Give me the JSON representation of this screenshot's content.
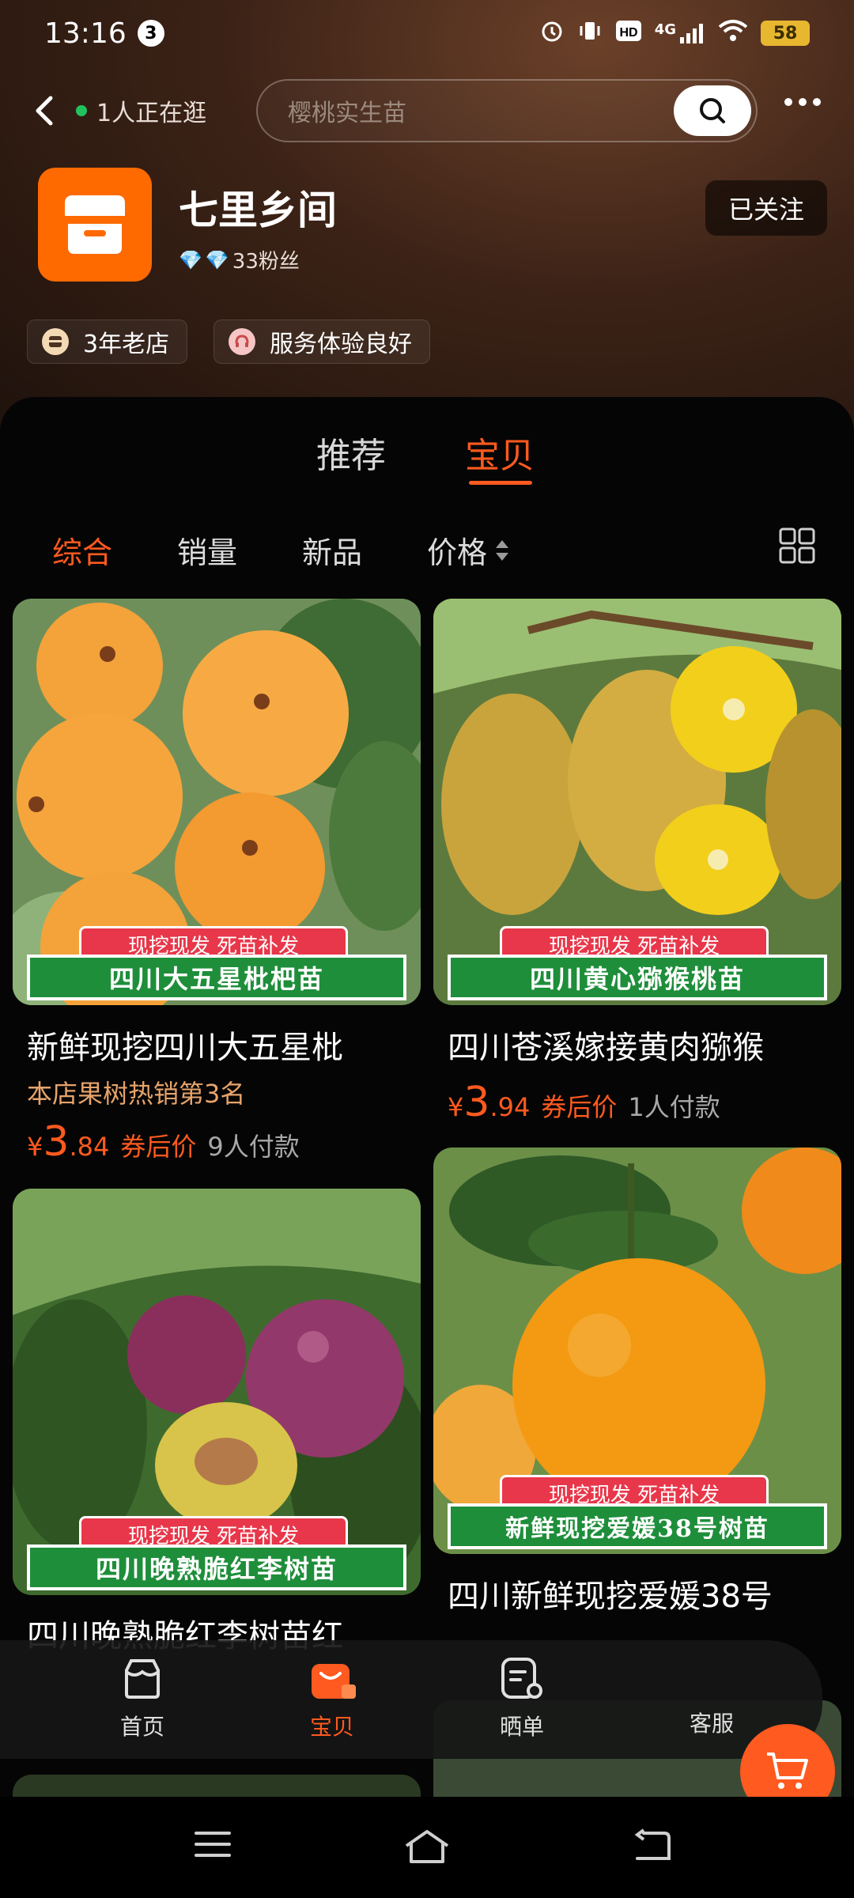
{
  "status_bar": {
    "time": "13:16",
    "notification_count": "3",
    "battery": "58",
    "network": "4G"
  },
  "top_bar": {
    "live_visitors": "1人正在逛",
    "search_placeholder": "樱桃实生苗"
  },
  "shop": {
    "name": "七里乡间",
    "fans": "33粉丝",
    "follow_label": "已关注",
    "tags": [
      "3年老店",
      "服务体验良好"
    ]
  },
  "main_tabs": {
    "recommend": "推荐",
    "products": "宝贝"
  },
  "sort": {
    "comprehensive": "综合",
    "sales": "销量",
    "new": "新品",
    "price": "价格"
  },
  "products": [
    {
      "promo_top": "现挖现发  死苗补发",
      "promo_bottom": "四川大五星枇杷苗",
      "title": "新鲜现挖四川大五星枇",
      "rank": "本店果树热销第3名",
      "price_symbol": "¥",
      "price_int": "3",
      "price_dec": ".84",
      "after_coupon": "券后价",
      "paid": "9人付款"
    },
    {
      "promo_top": "现挖现发  死苗补发",
      "promo_bottom": "四川黄心猕猴桃苗",
      "title": "四川苍溪嫁接黄肉猕猴",
      "price_symbol": "¥",
      "price_int": "3",
      "price_dec": ".94",
      "after_coupon": "券后价",
      "paid": "1人付款"
    },
    {
      "promo_top": "现挖现发  死苗补发",
      "promo_bottom": "四川晚熟脆红李树苗",
      "title": "四川晚熟脆红李树苗红"
    },
    {
      "promo_top": "现挖现发  死苗补发",
      "promo_bottom": "新鲜现挖爱媛38号树苗",
      "title": "四川新鲜现挖爱媛38号"
    }
  ],
  "bottom_nav": {
    "home": "首页",
    "products": "宝贝",
    "reviews": "晒单",
    "service": "客服"
  },
  "colors": {
    "accent": "#ff5a1f",
    "promo_red": "#e8374a",
    "promo_green": "#1e8e3a",
    "shop_logo": "#ff6a00"
  }
}
